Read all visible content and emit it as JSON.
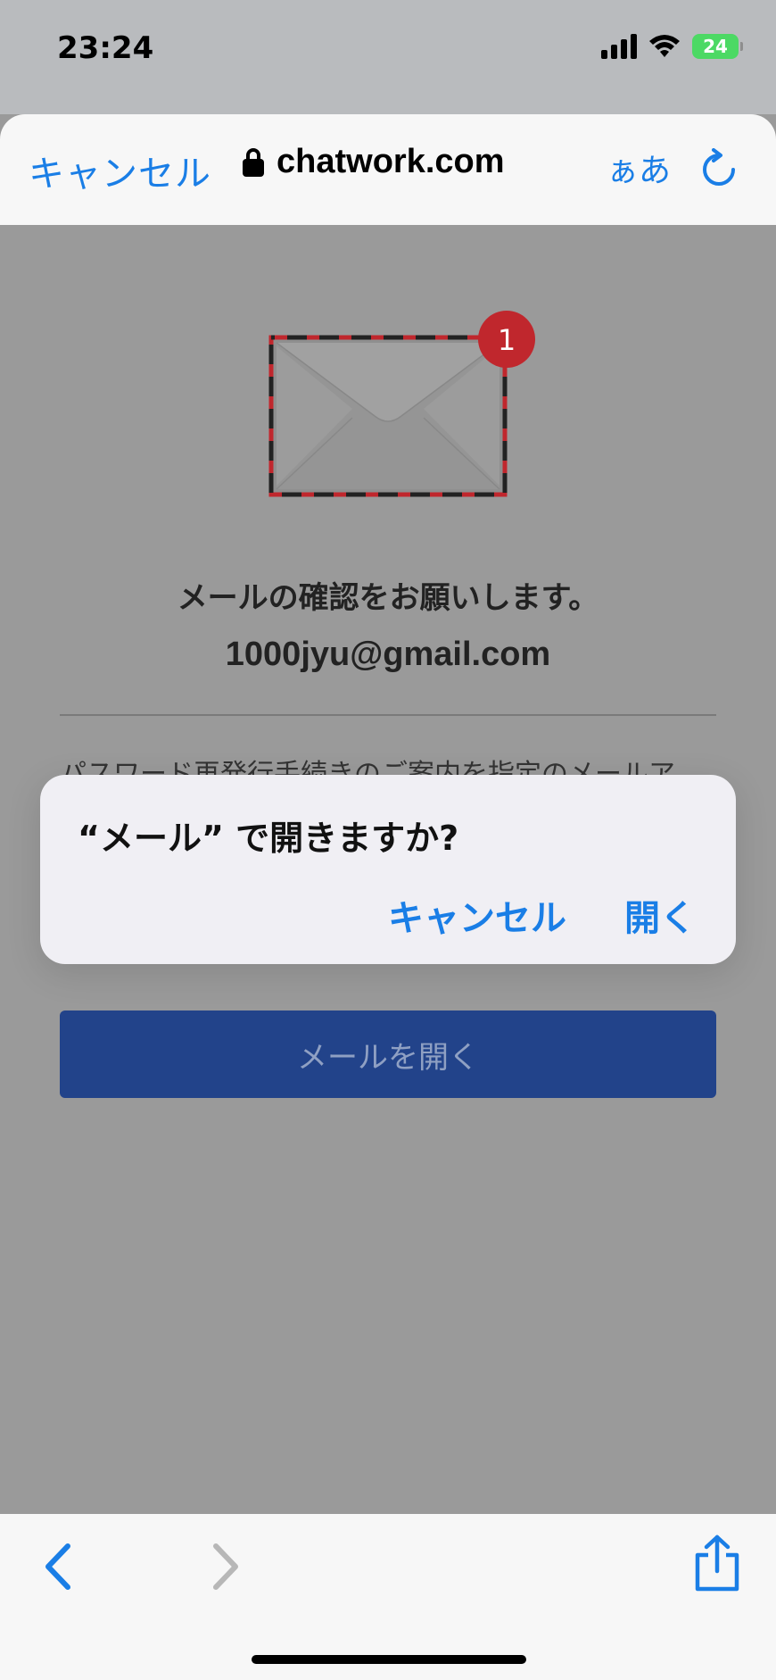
{
  "status_bar": {
    "time": "23:24",
    "battery": "24"
  },
  "browser": {
    "cancel_label": "キャンセル",
    "url": "chatwork.com",
    "text_size_label": "ぁあ"
  },
  "page": {
    "badge_count": "1",
    "heading": "メールの確認をお願いします。",
    "email": "1000jyu@gmail.com",
    "description": "パスワード再発行手続きのご案内を指定のメールア",
    "open_mail_button": "メールを開く"
  },
  "dialog": {
    "title": "“メール” で開きますか?",
    "cancel_label": "キャンセル",
    "open_label": "開く"
  },
  "colors": {
    "accent": "#1a7ee6",
    "button_bg": "#22438a",
    "badge": "#c0272d"
  }
}
